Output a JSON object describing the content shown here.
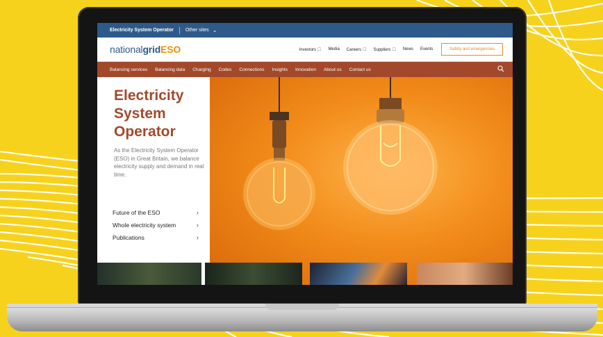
{
  "site": {
    "topbar": {
      "current_site": "Electricity System Operator",
      "other_sites": "Other sites"
    },
    "logo": {
      "part1": "national",
      "part2": "grid",
      "part3": "ESO"
    },
    "utility_links": [
      "Investors",
      "Media",
      "Careers",
      "Suppliers",
      "News",
      "Events"
    ],
    "external_marker": "☐",
    "safety_button": "Safety and emergencies",
    "nav": [
      "Balancing services",
      "Balancing data",
      "Charging",
      "Codes",
      "Connections",
      "Insights",
      "Innovation",
      "About us",
      "Contact us"
    ],
    "hero": {
      "title": "Electricity System Operator",
      "description": "As the Electricity System Operator (ESO) in Great Britain, we balance electricity supply and demand in real time.",
      "links": [
        "Future of the ESO",
        "Whole electricity system",
        "Publications"
      ]
    }
  },
  "icons": {
    "search": "search-icon",
    "chevron": "chevron-down-icon",
    "arrow": "chevron-right-icon"
  },
  "colors": {
    "background": "#f6d21d",
    "topbar": "#2e5a8a",
    "nav": "#a3492b",
    "accent": "#e59400",
    "hero_orange": "#f28c1a"
  }
}
